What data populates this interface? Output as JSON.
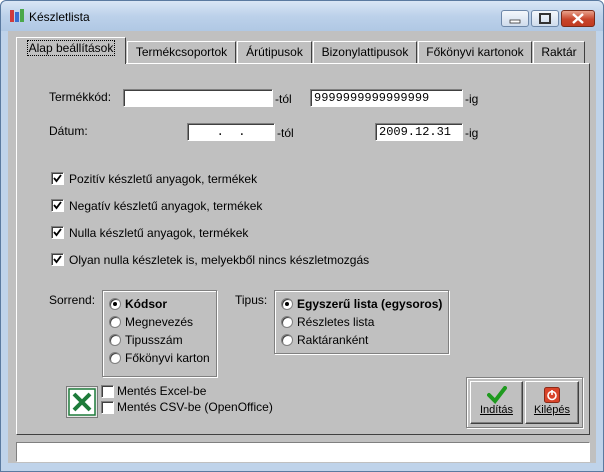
{
  "window": {
    "title": "Készletlista"
  },
  "tabs": [
    "Alap beállítások",
    "Termékcsoportok",
    "Árútipusok",
    "Bizonylattipusok",
    "Főkönyvi kartonok",
    "Raktár"
  ],
  "form": {
    "product_code_label": "Termékkód:",
    "product_code_from": "",
    "from_suffix": "-tól",
    "product_code_to": "9999999999999999",
    "to_suffix": "-ig",
    "date_label": "Dátum:",
    "date_from": "  .  .  ",
    "date_to": "2009.12.31"
  },
  "checkboxes": [
    {
      "label": "Pozitív készletű anyagok, termékek",
      "checked": true
    },
    {
      "label": "Negatív készletű anyagok, termékek",
      "checked": true
    },
    {
      "label": "Nulla készletű anyagok, termékek",
      "checked": true
    },
    {
      "label": "Olyan nulla készletek is, melyekből nincs készletmozgás",
      "checked": true
    }
  ],
  "sort": {
    "label": "Sorrend:",
    "options": [
      "Kódsor",
      "Megnevezés",
      "Tipusszám",
      "Főkönyvi karton"
    ],
    "selected": 0
  },
  "type": {
    "label": "Tipus:",
    "options": [
      "Egyszerű lista (egysoros)",
      "Részletes lista",
      "Raktáranként"
    ],
    "selected": 0
  },
  "export": {
    "excel_label": "Mentés Excel-be",
    "csv_label": "Mentés CSV-be (OpenOffice)"
  },
  "buttons": {
    "start_label": "Indítás",
    "exit_label": "Kilépés"
  },
  "colors": {
    "check_green": "#1f9a1f",
    "exit_red": "#d9442a",
    "excel_green": "#1e7b3a"
  }
}
